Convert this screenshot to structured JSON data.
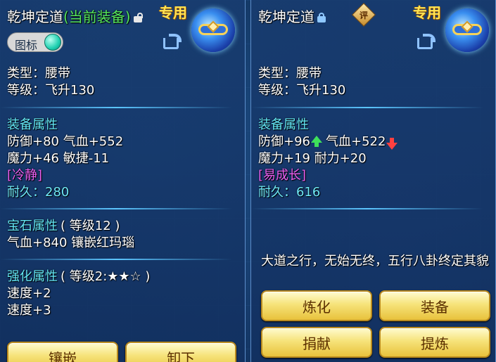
{
  "left": {
    "title": "乾坤定道",
    "title_status": "(当前装备)",
    "exclusive": "专用",
    "toggle_label": "图标",
    "type_line": "类型：腰带",
    "level_line": "等级：飞升130",
    "attr_header": "装备属性",
    "attr_line1": "防御+80 气血+552",
    "attr_line2": "魔力+46 敏捷-11",
    "special": "[冷静]",
    "durability_label": "耐久：",
    "durability_value": "280",
    "gem_header": "宝石属性",
    "gem_level": "( 等级12 )",
    "gem_line": "气血+840 镶嵌红玛瑙",
    "enhance_header": "强化属性",
    "enhance_level": "( 等级2:★★☆ )",
    "enhance_line1": "速度+2",
    "enhance_line2": "速度+3",
    "btn_inlay": "镶嵌",
    "btn_unequip": "卸下"
  },
  "right": {
    "title": "乾坤定道",
    "rate_badge": "评",
    "exclusive": "专用",
    "type_line": "类型：腰带",
    "level_line": "等级：飞升130",
    "attr_header": "装备属性",
    "attr_def": "防御+96",
    "attr_hp": "气血+522",
    "attr_line2": "魔力+19 耐力+20",
    "special": "[易成长]",
    "durability_label": "耐久：",
    "durability_value": "616",
    "description": "大道之行，无始无终，五行八卦终定其貌",
    "btn_refine": "炼化",
    "btn_equip": "装备",
    "btn_donate": "捐献",
    "btn_extract": "提炼"
  },
  "colors": {
    "section_header": "#62e5f4",
    "special": "#e95ff0",
    "current_tag": "#55e65c",
    "exclusive": "#ffe455",
    "button_text": "#5b2f00",
    "stat_up": "#3ee05a",
    "stat_down": "#ff4040"
  },
  "icons": {
    "left_lock": "unlock-icon",
    "right_lock": "lock-icon",
    "share": "share-icon",
    "item": "belt-item-icon",
    "stat_up": "arrow-up-icon",
    "stat_down": "arrow-down-icon"
  }
}
